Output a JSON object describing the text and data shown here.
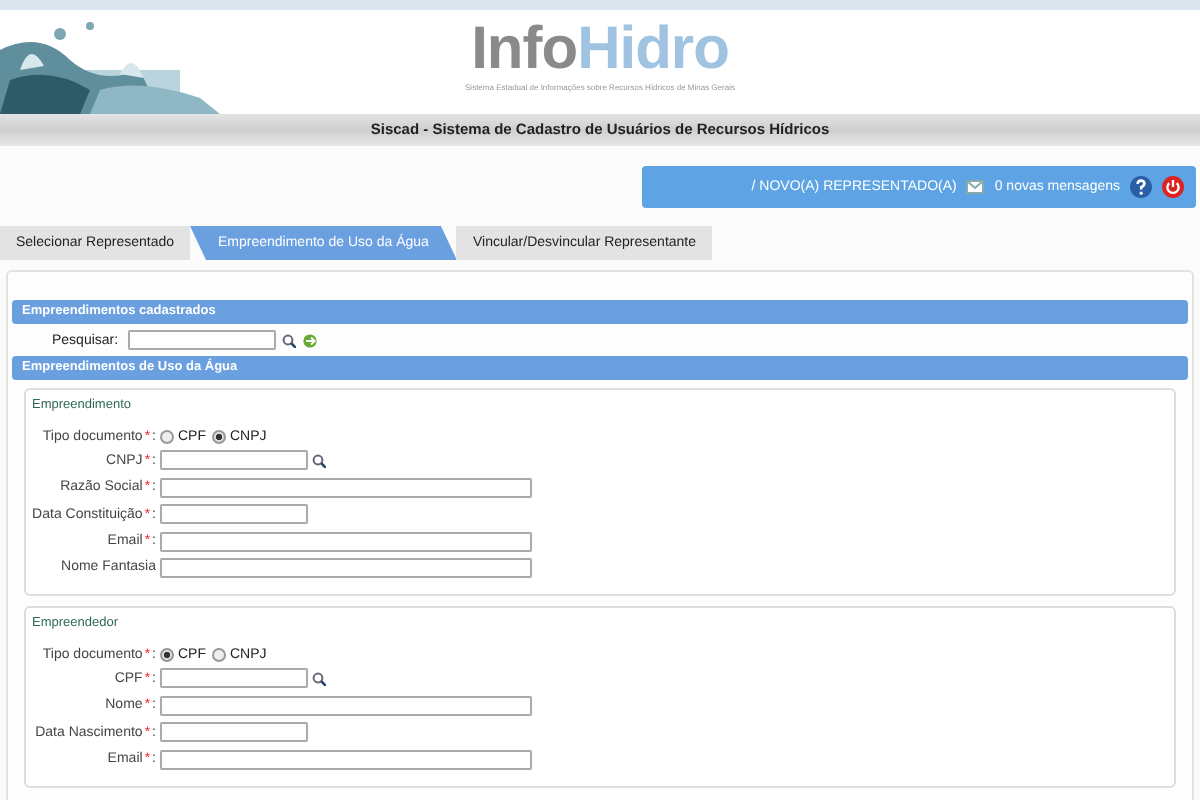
{
  "header": {
    "logo": {
      "part_1": "Info",
      "part_2": "Hidro"
    },
    "subtitle": "Sistema Estadual de Informações sobre Recursos Hídricos de Minas Gerais",
    "title": "Siscad - Sistema de Cadastro de Usuários de Recursos Hídricos"
  },
  "user_bar": {
    "user": "/  NOVO(A) REPRESENTADO(A)",
    "messages": "0 novas mensagens"
  },
  "tabs": [
    {
      "label": "Selecionar Representado",
      "selected": false
    },
    {
      "label": "Empreendimento de Uso da Água",
      "selected": true
    },
    {
      "label": "Vincular/Desvincular Representante",
      "selected": false
    }
  ],
  "registered": {
    "title": "Empreendimentos cadastrados",
    "search_label": "Pesquisar:"
  },
  "water_use": {
    "title": "Empreendimentos de Uso da Água",
    "groups": [
      {
        "title": "Empreendimento",
        "fields": [
          {
            "label": "Tipo documento",
            "asterisk": "*",
            "colon": ":",
            "kind": "radio",
            "options": [
              {
                "label": "CPF",
                "selected": false
              },
              {
                "label": "CNPJ",
                "selected": true
              }
            ]
          },
          {
            "label": "CNPJ",
            "asterisk": "*",
            "colon": ":",
            "kind": "search"
          },
          {
            "label": "Razão Social",
            "asterisk": "*",
            "colon": ":",
            "kind": "long"
          },
          {
            "label": "Data Constituição",
            "asterisk": "*",
            "colon": ":",
            "kind": "short"
          },
          {
            "label": "Email",
            "asterisk": "*",
            "colon": ":",
            "kind": "long"
          },
          {
            "label": "Nome Fantasia",
            "kind": "long"
          }
        ]
      },
      {
        "title": "Empreendedor",
        "fields": [
          {
            "label": "Tipo documento",
            "asterisk": "*",
            "colon": ":",
            "kind": "radio",
            "options": [
              {
                "label": "CPF",
                "selected": true
              },
              {
                "label": "CNPJ",
                "selected": false
              }
            ]
          },
          {
            "label": "CPF",
            "asterisk": "*",
            "colon": ":",
            "kind": "search"
          },
          {
            "label": "Nome",
            "asterisk": "*",
            "colon": ":",
            "kind": "long"
          },
          {
            "label": "Data Nascimento",
            "asterisk": "*",
            "colon": ":",
            "kind": "short"
          },
          {
            "label": "Email",
            "asterisk": "*",
            "colon": ":",
            "kind": "long"
          }
        ]
      }
    ]
  }
}
